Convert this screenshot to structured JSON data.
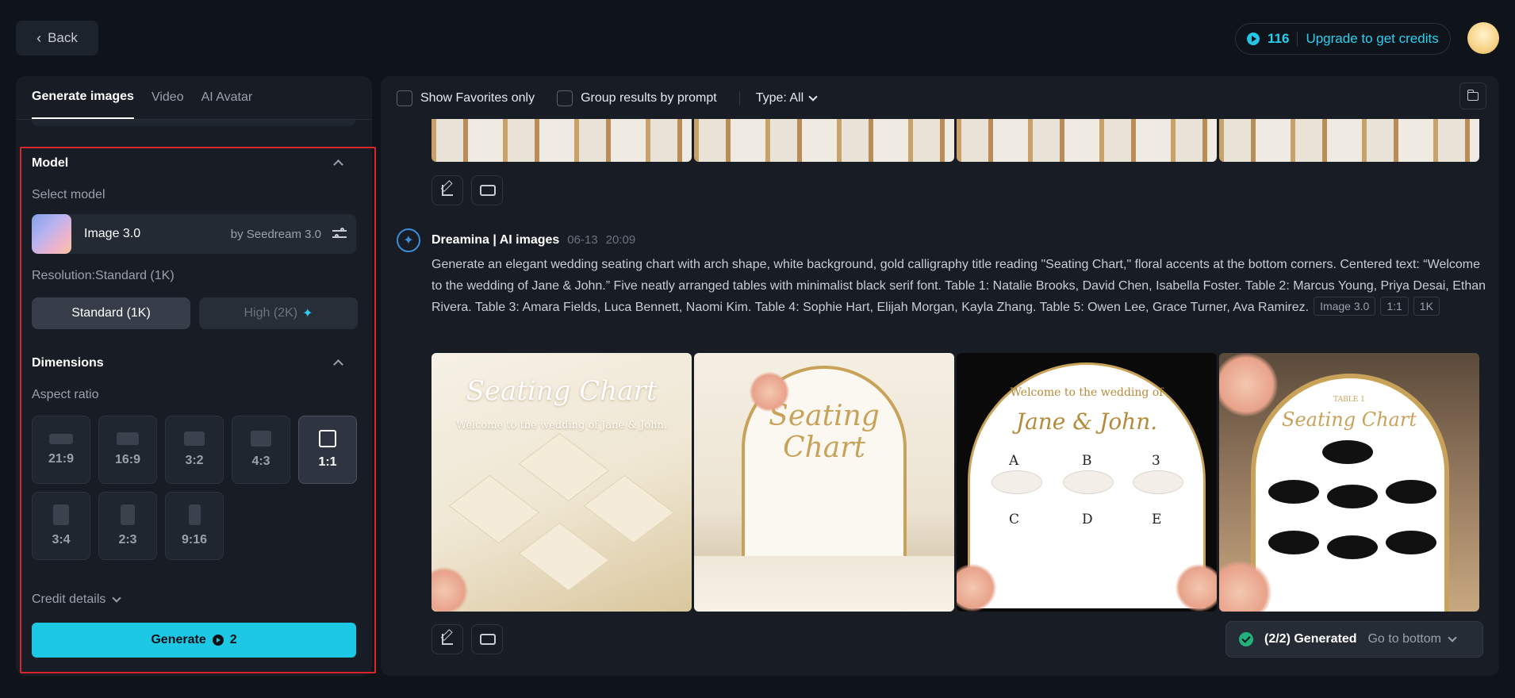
{
  "header": {
    "back_label": "Back",
    "credits": "116",
    "upgrade_label": "Upgrade to get credits"
  },
  "left_panel": {
    "tabs": [
      {
        "label": "Generate images",
        "active": true
      },
      {
        "label": "Video",
        "active": false
      },
      {
        "label": "AI Avatar",
        "active": false
      }
    ],
    "model_section": {
      "title": "Model",
      "select_label": "Select model",
      "model_name": "Image 3.0",
      "model_by": "by Seedream 3.0",
      "resolution_label": "Resolution:Standard (1K)",
      "res_standard": "Standard (1K)",
      "res_high": "High (2K)"
    },
    "dimensions_section": {
      "title": "Dimensions",
      "aspect_label": "Aspect ratio",
      "ratios": [
        "21:9",
        "16:9",
        "3:2",
        "4:3",
        "1:1",
        "3:4",
        "2:3",
        "9:16"
      ],
      "selected": "1:1"
    },
    "credit_details_label": "Credit details",
    "generate_label": "Generate",
    "generate_cost": "2"
  },
  "right_panel": {
    "filters": {
      "favorites_label": "Show Favorites only",
      "group_label": "Group results by prompt",
      "type_label": "Type: All"
    },
    "entry": {
      "author": "Dreamina | AI images",
      "date": "06-13",
      "time": "20:09",
      "prompt": "Generate an elegant wedding seating chart with arch shape, white background, gold calligraphy title reading \"Seating Chart,\" floral accents at the bottom corners. Centered text: “Welcome to the wedding of Jane & John.” Five neatly arranged tables with minimalist black serif font. Table 1: Natalie Brooks, David Chen, Isabella Foster. Table 2: Marcus Young, Priya Desai, Ethan Rivera. Table 3: Amara Fields, Luca Bennett, Naomi Kim. Table 4: Sophie Hart, Elijah Morgan, Kayla Zhang. Table 5: Owen Lee, Grace Turner, Ava Ramirez.",
      "tags": [
        "Image 3.0",
        "1:1",
        "1K"
      ],
      "images": [
        {
          "title": "Seating Chart",
          "subtitle": "Welcome to the wedding of Jane & John."
        },
        {
          "title": "Seating Chart"
        },
        {
          "title": "Jane & John.",
          "subtitle": "Welcome to the wedding of",
          "letters": [
            "A",
            "B",
            "3",
            "C",
            "D",
            "E"
          ]
        },
        {
          "title": "Seating Chart",
          "subtitle": "TABLE 1"
        }
      ]
    },
    "status": {
      "text": "(2/2) Generated",
      "goto_label": "Go to bottom"
    }
  }
}
